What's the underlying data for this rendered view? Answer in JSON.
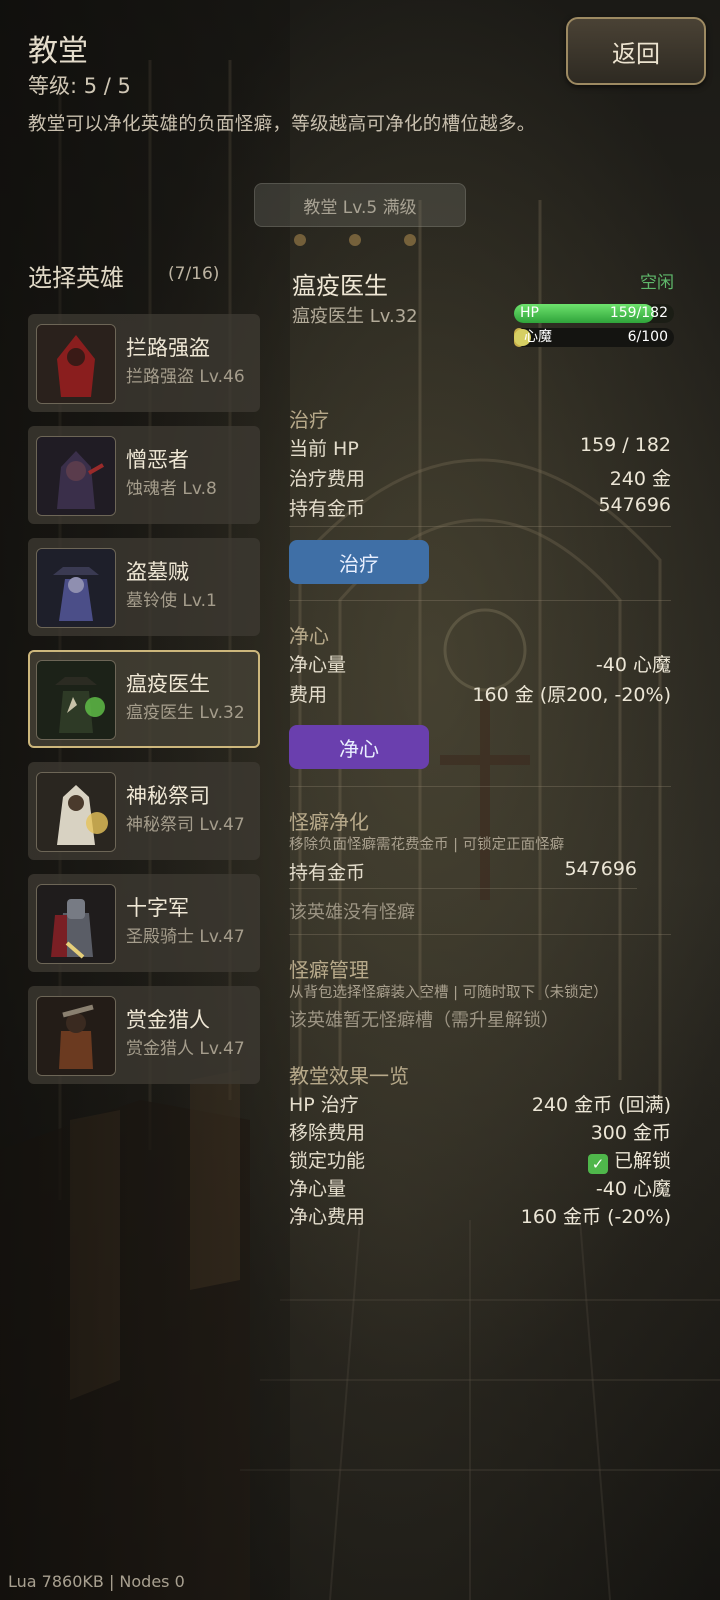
{
  "header": {
    "title": "教堂",
    "level": "等级: 5 / 5",
    "description": "教堂可以净化英雄的负面怪癖，等级越高可净化的槽位越多。",
    "back_label": "返回",
    "level_badge": "教堂 Lv.5 满级"
  },
  "hero_select": {
    "title": "选择英雄",
    "count": "(7/16)",
    "heroes": [
      {
        "name": "拦路强盗",
        "sub": "拦路强盗 Lv.46",
        "accent": "#8a1e1e"
      },
      {
        "name": "憎恶者",
        "sub": "蚀魂者 Lv.8",
        "accent": "#3a2f4a"
      },
      {
        "name": "盗墓贼",
        "sub": "墓铃使 Lv.1",
        "accent": "#4b4e88"
      },
      {
        "name": "瘟疫医生",
        "sub": "瘟疫医生 Lv.32",
        "accent": "#3f7a32"
      },
      {
        "name": "神秘祭司",
        "sub": "神秘祭司 Lv.47",
        "accent": "#c9b062"
      },
      {
        "name": "十字军",
        "sub": "圣殿骑士 Lv.47",
        "accent": "#7a1f24"
      },
      {
        "name": "赏金猎人",
        "sub": "赏金猎人 Lv.47",
        "accent": "#6b3a20"
      }
    ],
    "selected_index": 3
  },
  "hero_panel": {
    "name": "瘟疫医生",
    "sub": "瘟疫医生 Lv.32",
    "status": "空闲",
    "hp_label": "HP",
    "hp_value": "159/182",
    "hp_fraction": 0.874,
    "stress_label": "心魔",
    "stress_value": "6/100",
    "stress_fraction": 0.06
  },
  "heal": {
    "title": "治疗",
    "rows": [
      {
        "k": "当前 HP",
        "v": "159 / 182"
      },
      {
        "k": "治疗费用",
        "v": "240 金"
      },
      {
        "k": "持有金币",
        "v": "547696"
      }
    ],
    "button": "治疗"
  },
  "purify": {
    "title": "净心",
    "rows": [
      {
        "k": "净心量",
        "v": "-40 心魔"
      },
      {
        "k": "费用",
        "v": "160 金 (原200, -20%)"
      }
    ],
    "button": "净心"
  },
  "quirk_cleanse": {
    "title": "怪癖净化",
    "note": "移除负面怪癖需花费金币 | 可锁定正面怪癖",
    "gold_label": "持有金币",
    "gold_value": "547696",
    "empty": "该英雄没有怪癖"
  },
  "quirk_manage": {
    "title": "怪癖管理",
    "note": "从背包选择怪癖装入空槽 | 可随时取下（未锁定）",
    "empty": "该英雄暂无怪癖槽（需升星解锁）"
  },
  "effects": {
    "title": "教堂效果一览",
    "rows": [
      {
        "k": "HP 治疗",
        "v": "240 金币 (回满)"
      },
      {
        "k": "移除费用",
        "v": "300 金币"
      },
      {
        "k": "锁定功能",
        "v": "已解锁",
        "check": "✓"
      },
      {
        "k": "净心量",
        "v": "-40 心魔"
      },
      {
        "k": "净心费用",
        "v": "160 金币 (-20%)"
      }
    ]
  },
  "footer": "Lua 7860KB | Nodes 0"
}
